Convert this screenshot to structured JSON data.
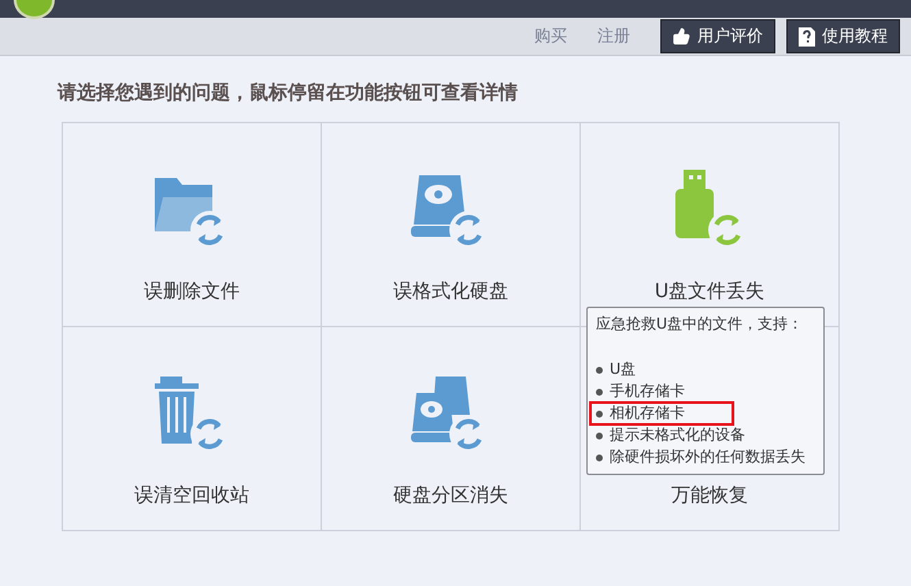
{
  "toolbar": {
    "links": [
      "购买",
      "注册"
    ],
    "buttons": [
      {
        "label": "用户评价",
        "kind": "thumb"
      },
      {
        "label": "使用教程",
        "kind": "guide"
      }
    ]
  },
  "heading": "请选择您遇到的问题，鼠标停留在功能按钮可查看详情",
  "options": [
    {
      "label": "误删除文件",
      "kind": "folder",
      "color": "#5b9bd1"
    },
    {
      "label": "误格式化硬盘",
      "kind": "disk",
      "color": "#5b9bd1"
    },
    {
      "label": "U盘文件丢失",
      "kind": "usb",
      "color": "#8cc63f"
    },
    {
      "label": "误清空回收站",
      "kind": "trash",
      "color": "#5b9bd1"
    },
    {
      "label": "硬盘分区消失",
      "kind": "disks",
      "color": "#5b9bd1"
    },
    {
      "label": "万能恢复",
      "kind": "none"
    }
  ],
  "tooltip": {
    "title": "应急抢救U盘中的文件，支持：",
    "items": [
      {
        "text": "U盘",
        "highlighted": false
      },
      {
        "text": "手机存储卡",
        "highlighted": false
      },
      {
        "text": "相机存储卡",
        "highlighted": true
      },
      {
        "text": "提示未格式化的设备",
        "highlighted": false
      },
      {
        "text": "除硬件损坏外的任何数据丢失",
        "highlighted": false
      }
    ]
  }
}
